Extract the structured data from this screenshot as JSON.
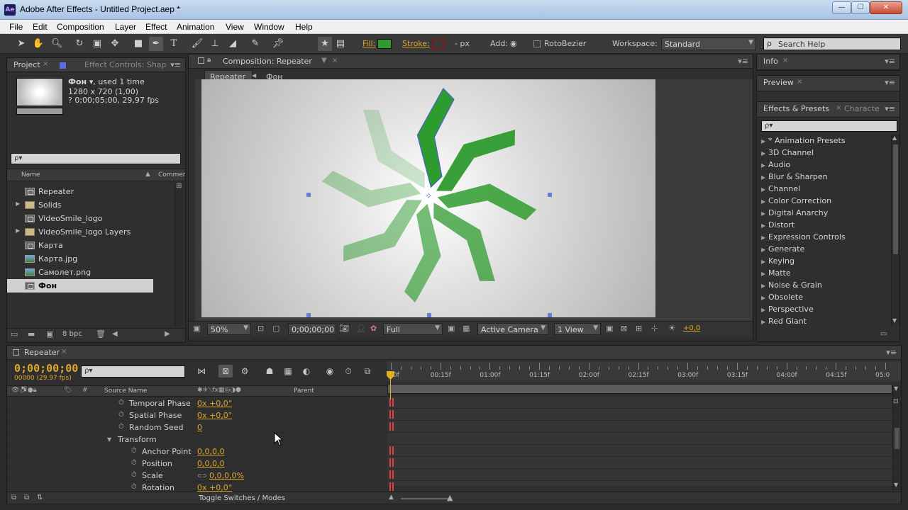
{
  "window": {
    "title": "Adobe After Effects - Untitled Project.aep *",
    "app_icon": "Ae"
  },
  "menu": [
    "File",
    "Edit",
    "Composition",
    "Layer",
    "Effect",
    "Animation",
    "View",
    "Window",
    "Help"
  ],
  "toolbar": {
    "fill_label": "Fill:",
    "fill_color": "#2e9b2e",
    "stroke_label": "Stroke:",
    "stroke_color": "#7a1a1a",
    "stroke_width": "- px",
    "add_label": "Add:",
    "rotobezier_label": "RotoBezier",
    "workspace_label": "Workspace:",
    "workspace_value": "Standard",
    "search_placeholder": "Search Help"
  },
  "project_panel": {
    "tab_project": "Project",
    "tab_effect_controls": "Effect Controls: Shap",
    "item_name": "Фон ▾",
    "item_used": ", used 1 time",
    "item_dims": "1280 x 720 (1,00)",
    "item_duration": "? 0;00;05;00, 29,97 fps",
    "search_placeholder": "ρ▾",
    "col_name": "Name",
    "col_comment": "Commen",
    "items": [
      {
        "label": "Repeater",
        "type": "comp",
        "caret": ""
      },
      {
        "label": "Solids",
        "type": "folder",
        "caret": "▶"
      },
      {
        "label": "VideoSmile_logo",
        "type": "comp",
        "caret": ""
      },
      {
        "label": "VideoSmile_logo Layers",
        "type": "folder",
        "caret": "▶"
      },
      {
        "label": "Карта",
        "type": "comp",
        "caret": ""
      },
      {
        "label": "Карта.jpg",
        "type": "image",
        "caret": ""
      },
      {
        "label": "Самолет.png",
        "type": "image",
        "caret": ""
      },
      {
        "label": "Фон",
        "type": "comp",
        "caret": "",
        "selected": true
      }
    ],
    "bpc": "8 bpc"
  },
  "composition_panel": {
    "tab": "Composition: Repeater",
    "breadcrumb_current": "Repeater",
    "breadcrumb_next": "Фон",
    "zoom": "50%",
    "timecode": "0;00;00;00",
    "resolution": "Full",
    "camera": "Active Camera",
    "views": "1 View",
    "exposure": "+0,0",
    "shape_color": "#2e9b2e"
  },
  "right_panels": {
    "info_tab": "Info",
    "preview_tab": "Preview",
    "effects_tab": "Effects & Presets",
    "character_tab": "Characte",
    "search_placeholder": "ρ▾",
    "effects": [
      "* Animation Presets",
      "3D Channel",
      "Audio",
      "Blur & Sharpen",
      "Channel",
      "Color Correction",
      "Digital Anarchy",
      "Distort",
      "Expression Controls",
      "Generate",
      "Keying",
      "Matte",
      "Noise & Grain",
      "Obsolete",
      "Perspective",
      "Red Giant"
    ]
  },
  "timeline": {
    "tab": "Repeater",
    "time": "0;00;00;00",
    "frame_count": "00000 (29.97 fps)",
    "search_placeholder": "ρ▾",
    "col_source": "Source Name",
    "col_parent": "Parent",
    "ruler_labels": [
      "0f",
      "00:15f",
      "01:00f",
      "01:15f",
      "02:00f",
      "02:15f",
      "03:00f",
      "03:15f",
      "04:00f",
      "04:15f",
      "05:0"
    ],
    "rows": [
      {
        "name": "Temporal Phase",
        "value": "0x +0,0°",
        "indent": 1,
        "stopwatch": true
      },
      {
        "name": "Spatial Phase",
        "value": "0x +0,0°",
        "indent": 1,
        "stopwatch": true
      },
      {
        "name": "Random Seed",
        "value": "0",
        "indent": 1,
        "stopwatch": true
      },
      {
        "name": "Transform",
        "value": "",
        "indent": 0,
        "stopwatch": false,
        "caret": "▼"
      },
      {
        "name": "Anchor Point",
        "value": "0,0,0,0",
        "indent": 2,
        "stopwatch": true
      },
      {
        "name": "Position",
        "value": "0,0,0,0",
        "indent": 2,
        "stopwatch": true
      },
      {
        "name": "Scale",
        "value": "0,0,0,0%",
        "indent": 2,
        "stopwatch": true,
        "link": true
      },
      {
        "name": "Rotation",
        "value": "0x +0,0°",
        "indent": 2,
        "stopwatch": true
      }
    ],
    "toggle_label": "Toggle Switches / Modes"
  }
}
